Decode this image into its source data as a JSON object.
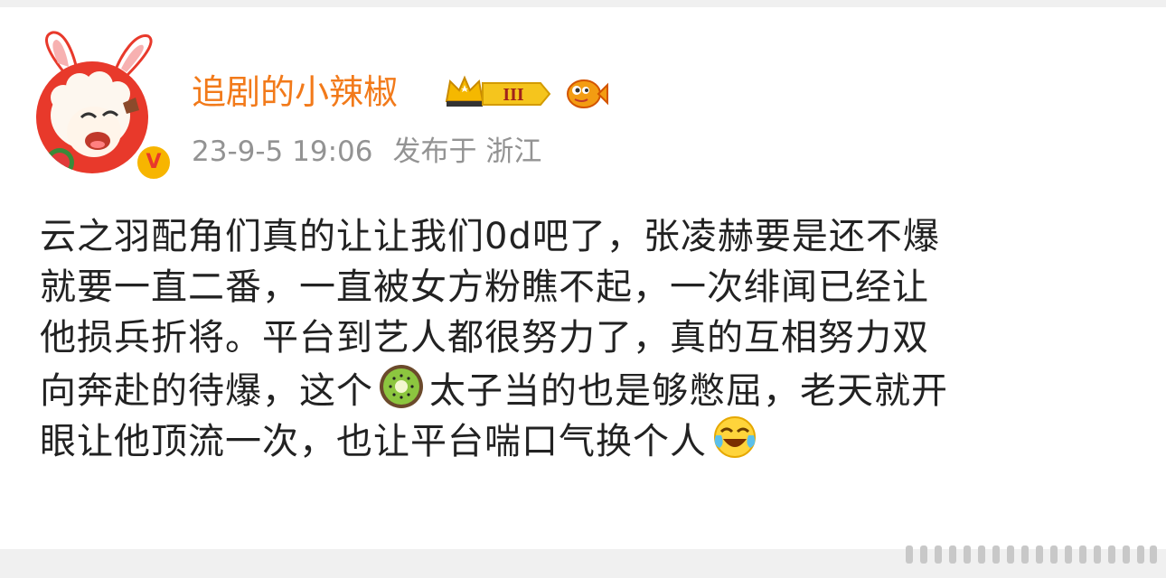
{
  "post": {
    "username": "追剧的小辣椒",
    "level_badge": "III",
    "timestamp": "23-9-5 19:06",
    "source": "发布于 浙江",
    "content_lines": [
      {
        "pre": "云之羽配角们真的让让我们0d吧了，张凌赫要是还不爆",
        "post": ""
      },
      {
        "pre": "就要一直二番，一直被女方粉瞧不起，一次绯闻已经让",
        "post": ""
      },
      {
        "pre": "他损兵折将。平台到艺人都很努力了，真的互相努力双",
        "post": ""
      },
      {
        "pre": "向奔赴的待爆，这个",
        "emoji": "kiwi-emoji",
        "post": "太子当的也是够憋屈，老天就开"
      },
      {
        "pre": "眼让他顶流一次，也让平台喘口气换个人",
        "emoji": "laughing-crying-emoji",
        "post": ""
      }
    ]
  },
  "colors": {
    "username": "#f27a1a",
    "meta": "#939393",
    "text": "#222222",
    "avatar_bg": "#e8392b",
    "verified_bg": "#f7b500"
  },
  "icons": [
    "avatar-sheep",
    "verified-v-icon",
    "crown-level-badge",
    "fish-fan-badge",
    "kiwi-emoji",
    "laughing-crying-emoji"
  ]
}
